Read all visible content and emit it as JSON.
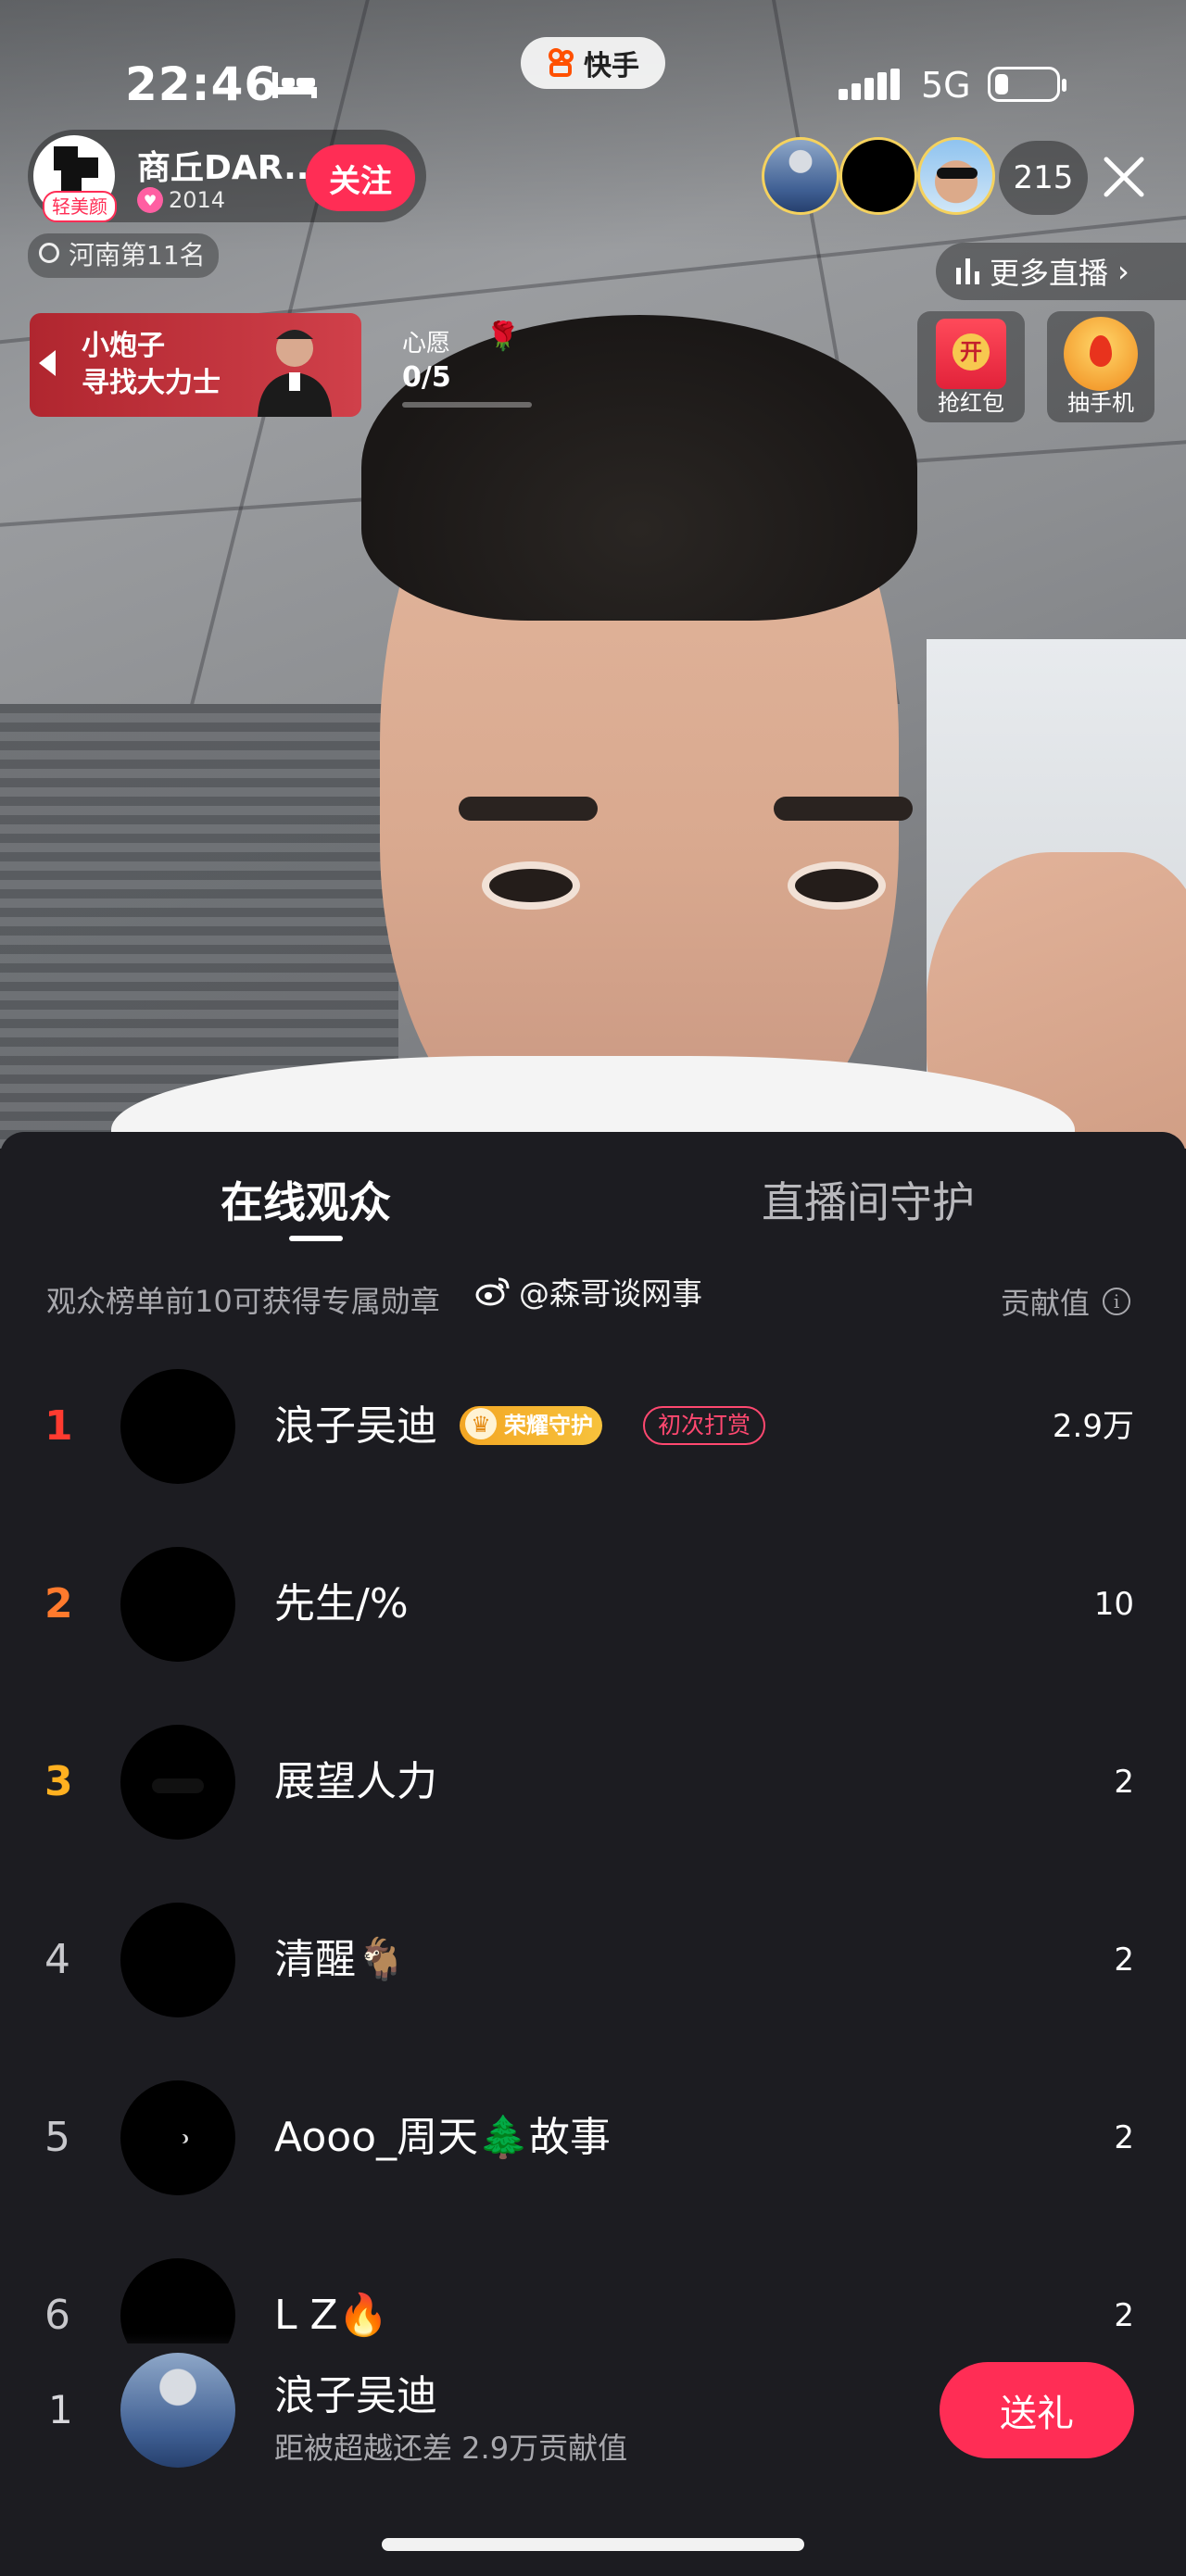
{
  "status_bar": {
    "time": "22:46",
    "network": "5G"
  },
  "app": {
    "name": "快手"
  },
  "anchor": {
    "name": "商丘DAR...",
    "likes": "2014",
    "beauty_tag": "轻美颜",
    "follow_label": "关注",
    "rank_text": "河南第11名"
  },
  "viewers": {
    "count": "215"
  },
  "more_live_label": "更多直播",
  "promo": {
    "line1": "小炮子",
    "line2": "寻找大力士"
  },
  "wish": {
    "title": "心愿",
    "count": "0/5"
  },
  "events": {
    "red_packet": "抢红包",
    "lottery": "抽手机"
  },
  "tabs": {
    "online": "在线观众",
    "guard": "直播间守护"
  },
  "hint": "观众榜单前10可获得专属勋章",
  "watermark": "@森哥谈网事",
  "contrib_label": "贡献值",
  "ranking": [
    {
      "rank": "1",
      "name": "浪子吴迪",
      "score": "2.9万",
      "badge_honor": "荣耀守护",
      "badge_first": "初次打赏",
      "rank_color": "#ff3b30"
    },
    {
      "rank": "2",
      "name": "先生/%",
      "score": "10",
      "rank_color": "#ff7a2d"
    },
    {
      "rank": "3",
      "name": "展望人力",
      "score": "2",
      "rank_color": "#ffb020"
    },
    {
      "rank": "4",
      "name": "清醒🐐",
      "score": "2",
      "rank_color": "#c8c8cc"
    },
    {
      "rank": "5",
      "name": "Aooo_周天🌲故事",
      "score": "2",
      "rank_color": "#c8c8cc"
    },
    {
      "rank": "6",
      "name": "L Z🔥",
      "score": "2",
      "rank_color": "#c8c8cc"
    }
  ],
  "me": {
    "rank": "1",
    "name": "浪子吴迪",
    "sub": "距被超越还差 2.9万贡献值",
    "gift_label": "送礼"
  }
}
